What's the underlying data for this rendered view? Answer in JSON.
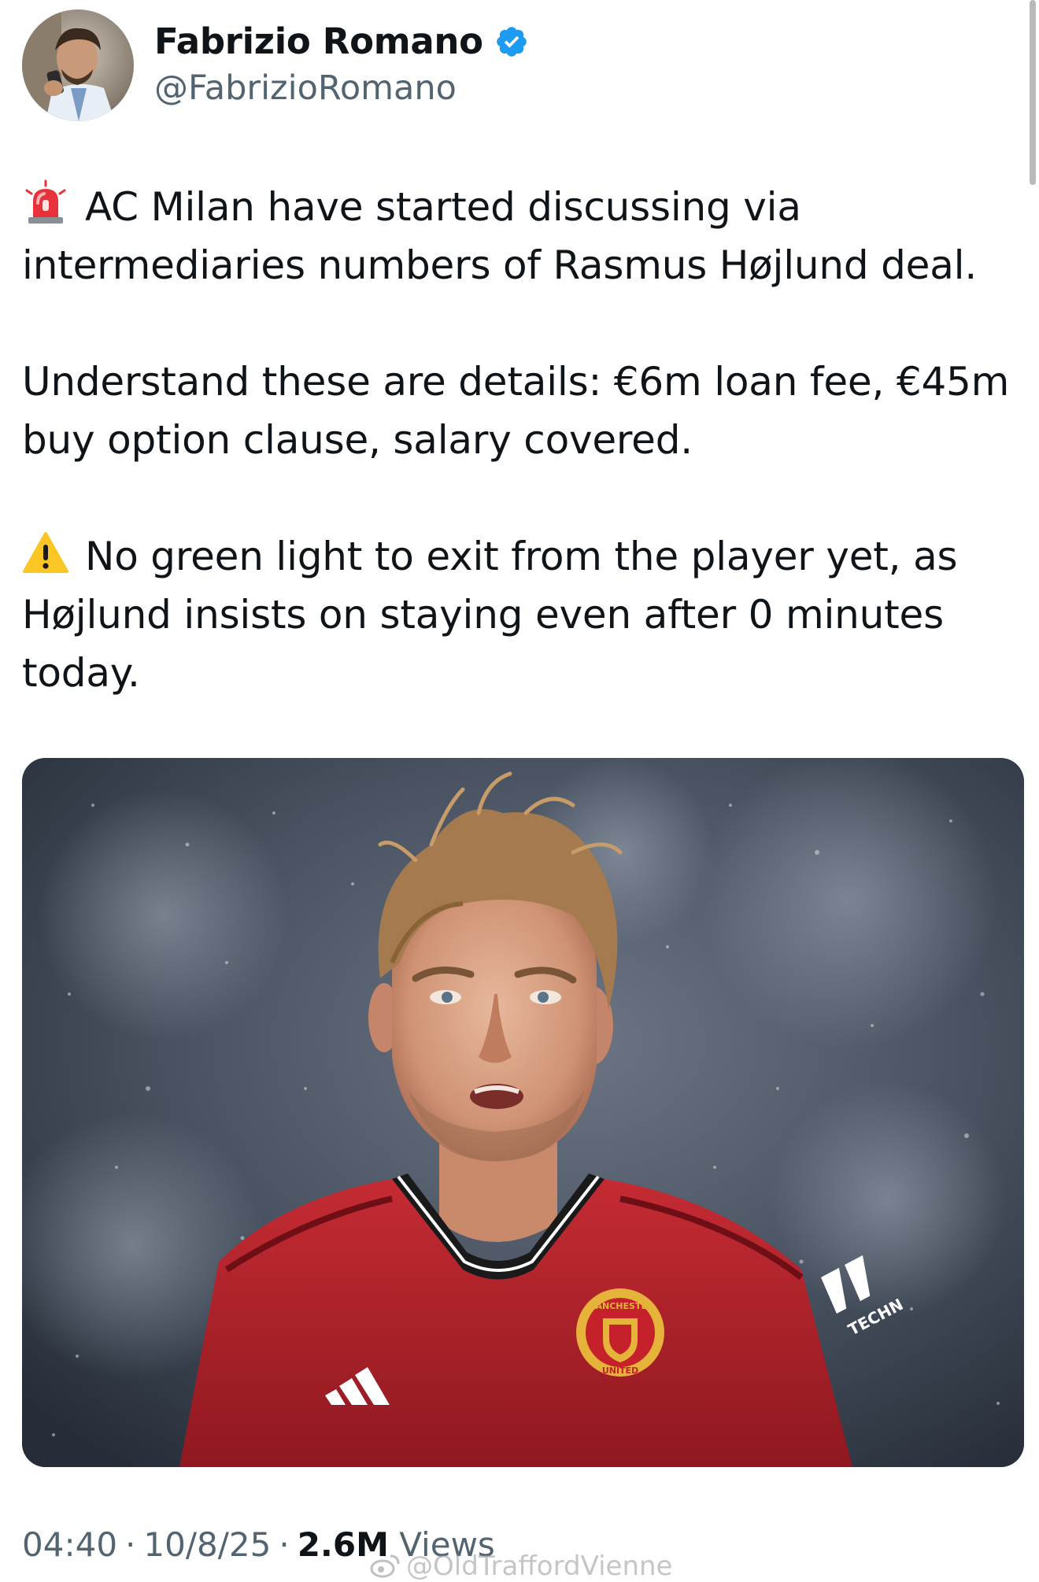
{
  "author": {
    "display_name": "Fabrizio Romano",
    "handle": "@FabrizioRomano",
    "verified": true,
    "avatar_icon": "avatar-photo"
  },
  "tweet": {
    "paragraphs": [
      {
        "emoji": "rotating-light-icon",
        "text": "AC Milan have started discussing via intermediaries numbers of Rasmus Højlund deal."
      },
      {
        "emoji": "",
        "text": "Understand these are details: €6m loan fee, €45m buy option clause, salary covered."
      },
      {
        "emoji": "warning-icon",
        "text": "No green light to exit from the player yet, as Højlund insists on staying even after 0 minutes today."
      }
    ]
  },
  "media": {
    "kind": "photo",
    "logo_text_top": "MANCHESTER",
    "logo_text_bottom": "UNITED",
    "sponsor_text": "TECHN"
  },
  "meta": {
    "time": "04:40",
    "date": "10/8/25",
    "separator": "·",
    "views_count": "2.6M",
    "views_label": "Views"
  },
  "watermark": {
    "text": "@OldTraffordVienne",
    "icon": "weibo-icon"
  },
  "colors": {
    "text": "#0f1419",
    "secondary": "#536471",
    "verified": "#1d9bf0",
    "jersey": "#b8222c"
  }
}
